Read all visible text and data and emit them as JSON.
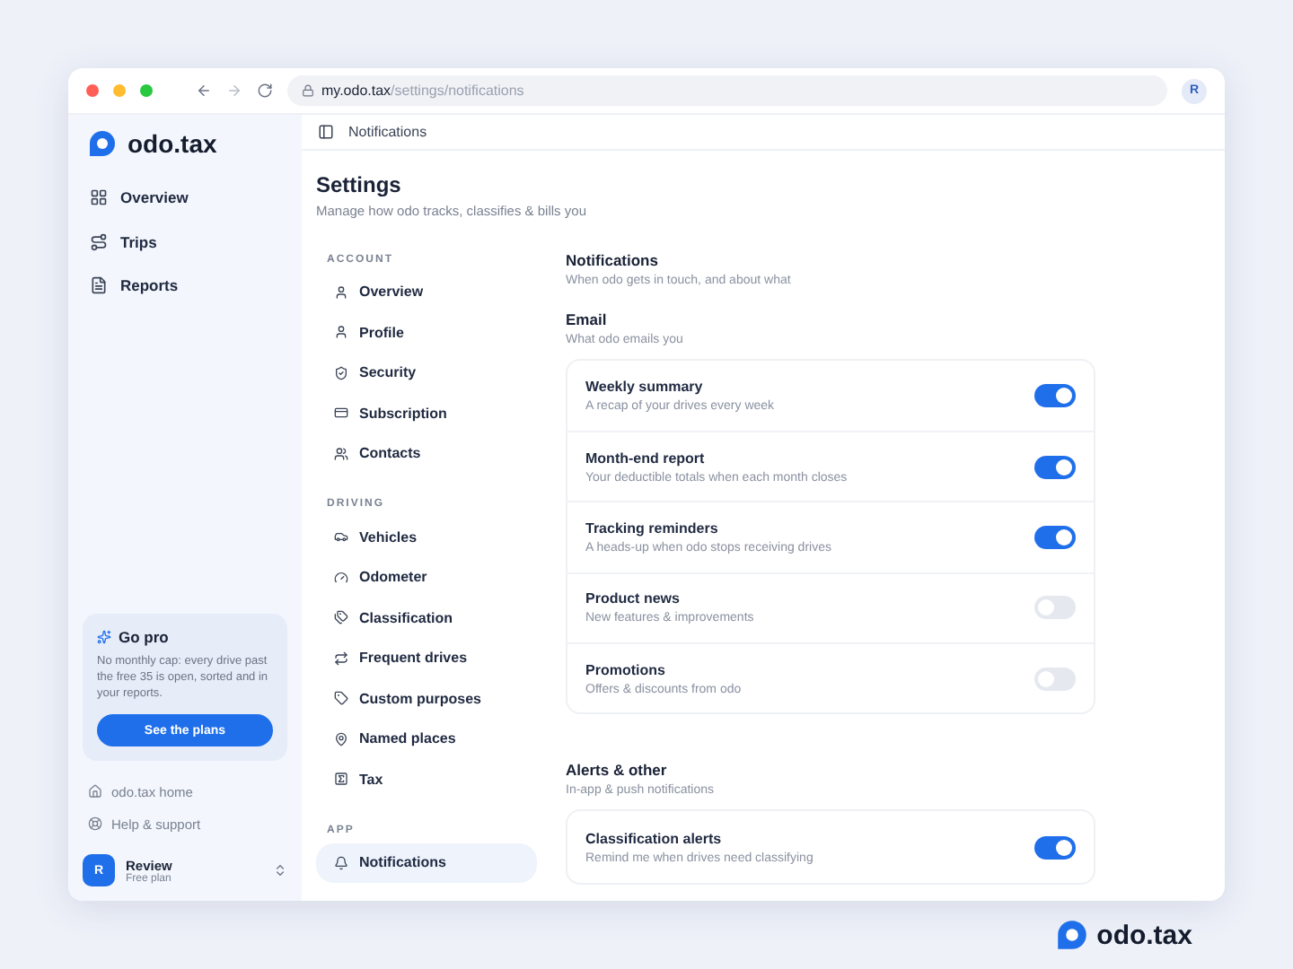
{
  "browser": {
    "url_host": "my.odo.tax",
    "url_path": "/settings/notifications",
    "avatar": "R"
  },
  "sidebar": {
    "brand": "odo.tax",
    "items": [
      {
        "label": "Overview"
      },
      {
        "label": "Trips"
      },
      {
        "label": "Reports"
      }
    ],
    "promo": {
      "title": "Go pro",
      "body": "No monthly cap: every drive past the free 35 is open, sorted and in your reports.",
      "button": "See the plans"
    },
    "links": [
      "odo.tax home",
      "Help & support"
    ],
    "user": {
      "initial": "R",
      "name": "Review",
      "plan": "Free plan"
    }
  },
  "header": {
    "title": "Notifications"
  },
  "settings": {
    "title": "Settings",
    "subtitle": "Manage how odo tracks, classifies & bills you",
    "nav": [
      {
        "heading": "ACCOUNT",
        "items": [
          {
            "label": "Overview",
            "selected": false
          },
          {
            "label": "Profile",
            "selected": false
          },
          {
            "label": "Security",
            "selected": false
          },
          {
            "label": "Subscription",
            "selected": false
          },
          {
            "label": "Contacts",
            "selected": false
          }
        ]
      },
      {
        "heading": "DRIVING",
        "items": [
          {
            "label": "Vehicles",
            "selected": false
          },
          {
            "label": "Odometer",
            "selected": false
          },
          {
            "label": "Classification",
            "selected": false
          },
          {
            "label": "Frequent drives",
            "selected": false
          },
          {
            "label": "Custom purposes",
            "selected": false
          },
          {
            "label": "Named places",
            "selected": false
          },
          {
            "label": "Tax",
            "selected": false
          }
        ]
      },
      {
        "heading": "APP",
        "items": [
          {
            "label": "Notifications",
            "selected": true
          }
        ]
      }
    ],
    "panel": {
      "title": "Notifications",
      "subtitle": "When odo gets in touch, and about what",
      "groups": [
        {
          "title": "Email",
          "subtitle": "What odo emails you",
          "rows": [
            {
              "title": "Weekly summary",
              "desc": "A recap of your drives every week",
              "on": true
            },
            {
              "title": "Month-end report",
              "desc": "Your deductible totals when each month closes",
              "on": true
            },
            {
              "title": "Tracking reminders",
              "desc": "A heads-up when odo stops receiving drives",
              "on": true
            },
            {
              "title": "Product news",
              "desc": "New features & improvements",
              "on": false
            },
            {
              "title": "Promotions",
              "desc": "Offers & discounts from odo",
              "on": false
            }
          ]
        },
        {
          "title": "Alerts & other",
          "subtitle": "In-app & push notifications",
          "rows": [
            {
              "title": "Classification alerts",
              "desc": "Remind me when drives need classifying",
              "on": true
            }
          ]
        }
      ]
    }
  },
  "footer": {
    "brand": "odo.tax"
  }
}
